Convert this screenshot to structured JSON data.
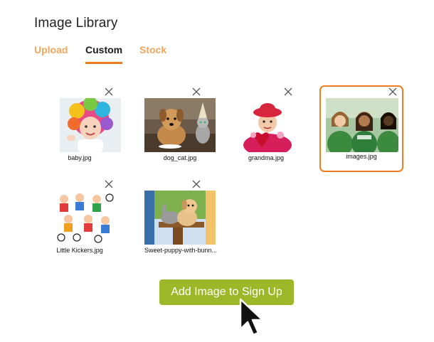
{
  "header": {
    "title": "Image Library"
  },
  "tabs": [
    {
      "label": "Upload",
      "active": false
    },
    {
      "label": "Custom",
      "active": true
    },
    {
      "label": "Stock",
      "active": false
    }
  ],
  "images": [
    {
      "caption": "baby.jpg",
      "selected": false
    },
    {
      "caption": "dog_cat.jpg",
      "selected": false
    },
    {
      "caption": "grandma.jpg",
      "selected": false
    },
    {
      "caption": "images.jpg",
      "selected": true
    },
    {
      "caption": "Little Kickers.jpg",
      "selected": false
    },
    {
      "caption": "Sweet-puppy-with-bunn...",
      "selected": false
    }
  ],
  "actions": {
    "add_label": "Add Image to Sign Up"
  },
  "colors": {
    "accent": "#ee7d1e",
    "tab_inactive": "#f2a55c",
    "button": "#9cb728"
  },
  "icons": {
    "remove": "close-icon",
    "pointer": "mouse-cursor-icon"
  }
}
